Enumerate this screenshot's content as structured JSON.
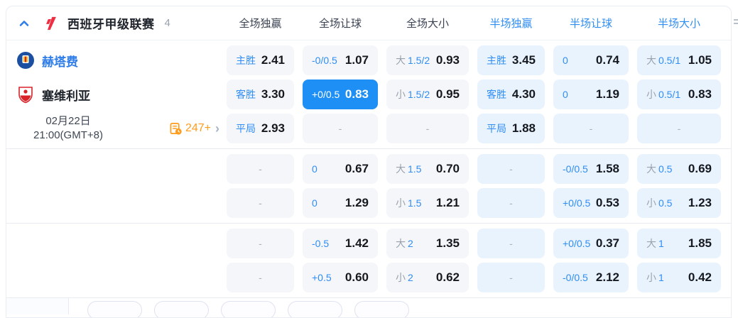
{
  "header": {
    "league": "西班牙甲级联赛",
    "count": "4",
    "columns": [
      {
        "label": "全场独赢",
        "half": false
      },
      {
        "label": "全场让球",
        "half": false
      },
      {
        "label": "全场大小",
        "half": false
      },
      {
        "label": "半场独赢",
        "half": true
      },
      {
        "label": "半场让球",
        "half": true
      },
      {
        "label": "半场大小",
        "half": true
      }
    ]
  },
  "match": {
    "home_team": "赫塔费",
    "away_team": "塞维利亚",
    "date_line1": "02月22日",
    "date_line2": "21:00(GMT+8)",
    "more_markets_count": "247+",
    "more_markets_arrow": "›"
  },
  "odds": {
    "dash": "-",
    "sections": [
      {
        "rows": [
          {
            "cells": [
              {
                "l": "主胜",
                "v": "2.41"
              },
              {
                "l": "-0/0.5",
                "v": "1.07"
              },
              {
                "p": "大",
                "l": "1.5/2",
                "v": "0.93"
              },
              {
                "l": "主胜",
                "v": "3.45"
              },
              {
                "l": "0",
                "v": "0.74"
              },
              {
                "p": "大",
                "l": "0.5/1",
                "v": "1.05"
              }
            ]
          },
          {
            "cells": [
              {
                "l": "客胜",
                "v": "3.30"
              },
              {
                "l": "+0/0.5",
                "v": "0.83",
                "sel": true
              },
              {
                "p": "小",
                "l": "1.5/2",
                "v": "0.95"
              },
              {
                "l": "客胜",
                "v": "4.30"
              },
              {
                "l": "0",
                "v": "1.19"
              },
              {
                "p": "小",
                "l": "0.5/1",
                "v": "0.83"
              }
            ]
          },
          {
            "cells": [
              {
                "l": "平局",
                "v": "2.93"
              },
              {
                "dash": true
              },
              {
                "dash": true
              },
              {
                "l": "平局",
                "v": "1.88"
              },
              {
                "dash": true
              },
              {
                "dash": true
              }
            ]
          }
        ]
      },
      {
        "rows": [
          {
            "cells": [
              {
                "dash": true
              },
              {
                "l": "0",
                "v": "0.67"
              },
              {
                "p": "大",
                "l": "1.5",
                "v": "0.70"
              },
              {
                "dash": true
              },
              {
                "l": "-0/0.5",
                "v": "1.58"
              },
              {
                "p": "大",
                "l": "0.5",
                "v": "0.69"
              }
            ]
          },
          {
            "cells": [
              {
                "dash": true
              },
              {
                "l": "0",
                "v": "1.29"
              },
              {
                "p": "小",
                "l": "1.5",
                "v": "1.21"
              },
              {
                "dash": true
              },
              {
                "l": "+0/0.5",
                "v": "0.53"
              },
              {
                "p": "小",
                "l": "0.5",
                "v": "1.23"
              }
            ]
          }
        ]
      },
      {
        "rows": [
          {
            "cells": [
              {
                "dash": true
              },
              {
                "l": "-0.5",
                "v": "1.42"
              },
              {
                "p": "大",
                "l": "2",
                "v": "1.35"
              },
              {
                "dash": true
              },
              {
                "l": "+0/0.5",
                "v": "0.37"
              },
              {
                "p": "大",
                "l": "1",
                "v": "1.85"
              }
            ]
          },
          {
            "cells": [
              {
                "dash": true
              },
              {
                "l": "+0.5",
                "v": "0.60"
              },
              {
                "p": "小",
                "l": "2",
                "v": "0.62"
              },
              {
                "dash": true
              },
              {
                "l": "-0/0.5",
                "v": "2.12"
              },
              {
                "p": "小",
                "l": "1",
                "v": "0.42"
              }
            ]
          }
        ]
      }
    ]
  },
  "footer": {
    "chip_count": 5
  },
  "colors": {
    "accent_blue": "#2f8df4",
    "selected_cell": "#1e8ff5",
    "orange": "#ff9c1c",
    "league_logo_red": "#ef2e41"
  }
}
